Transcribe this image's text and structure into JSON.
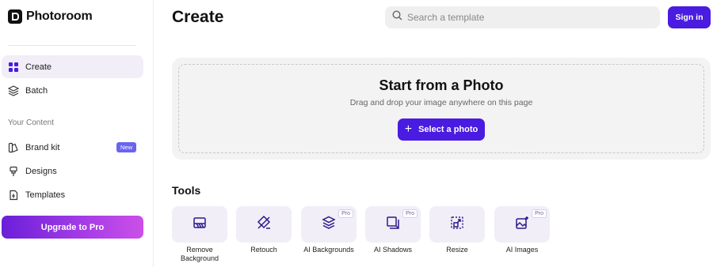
{
  "brand": {
    "name": "Photoroom"
  },
  "sidebar": {
    "items": [
      {
        "label": "Create",
        "icon": "grid-icon",
        "active": true
      },
      {
        "label": "Batch",
        "icon": "layers-icon",
        "active": false
      }
    ],
    "section_label": "Your Content",
    "content_items": [
      {
        "label": "Brand kit",
        "icon": "brand-kit-icon",
        "badge": "New"
      },
      {
        "label": "Designs",
        "icon": "designs-icon"
      },
      {
        "label": "Templates",
        "icon": "templates-icon"
      }
    ],
    "upgrade_label": "Upgrade to Pro"
  },
  "header": {
    "title": "Create",
    "search_placeholder": "Search a template",
    "signin_label": "Sign in"
  },
  "upload": {
    "title": "Start from a Photo",
    "subtitle": "Drag and drop your image anywhere on this page",
    "button_label": "Select a photo"
  },
  "tools": {
    "title": "Tools",
    "items": [
      {
        "label": "Remove Background",
        "icon": "remove-background-icon",
        "pro": false
      },
      {
        "label": "Retouch",
        "icon": "retouch-icon",
        "pro": false
      },
      {
        "label": "AI Backgrounds",
        "icon": "ai-backgrounds-icon",
        "pro": true
      },
      {
        "label": "AI Shadows",
        "icon": "ai-shadows-icon",
        "pro": true
      },
      {
        "label": "Resize",
        "icon": "resize-icon",
        "pro": false
      },
      {
        "label": "AI Images",
        "icon": "ai-images-icon",
        "pro": true
      }
    ],
    "pro_label": "Pro"
  },
  "colors": {
    "accent": "#4a1be0",
    "sidebar_active_bg": "#f1eef8",
    "new_badge": "#6a64f0"
  }
}
